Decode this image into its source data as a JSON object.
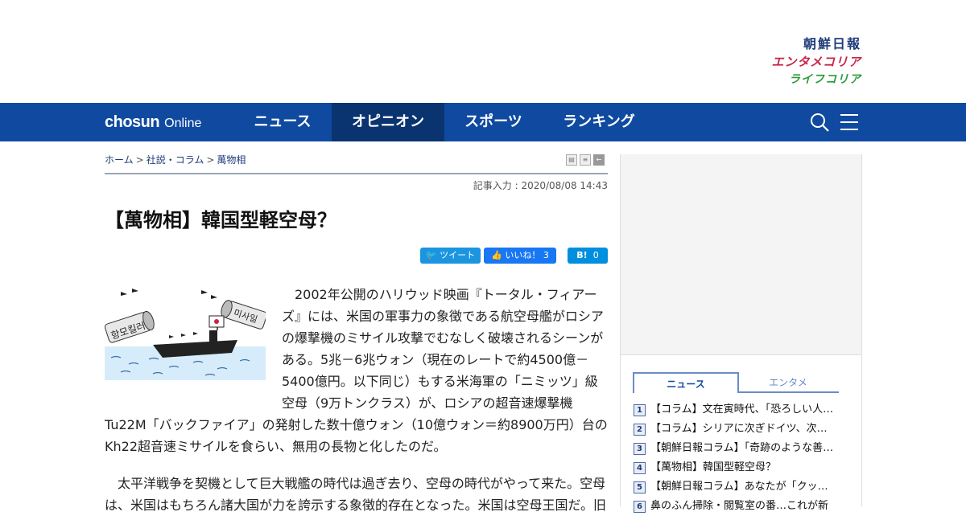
{
  "brands": {
    "main": "朝鮮日報",
    "enta": "エンタメコリア",
    "life": "ライフコリア"
  },
  "nav": {
    "logo_main": "chosun",
    "logo_sub": "Online",
    "items": [
      "ニュース",
      "オピニオン",
      "スポーツ",
      "ランキング"
    ],
    "active": "オピニオン",
    "icons": [
      "search-icon",
      "menu-icon"
    ]
  },
  "breadcrumb": {
    "home": "ホーム",
    "section": "社説・コラム",
    "current": "萬物相",
    "sep": ">"
  },
  "article": {
    "posted": "記事入力 : 2020/08/08 14:43",
    "title": "【萬物相】韓国型軽空母？",
    "image_text": {
      "left": "항모킬러",
      "right": "미사일"
    },
    "paragraphs": [
      "　2002年公開のハリウッド映画『トータル・フィアーズ』には、米国の軍事力の象徴である航空母艦がロシアの爆撃機のミサイル攻撃でむなしく破壊されるシーンがある。5兆－6兆ウォン（現在のレートで約4500億－5400億円。以下同じ）もする米海軍の「ニミッツ」級空母（9万トンクラス）が、ロシアの超音速爆撃機Tu22M「バックファイア」の発射した数十億ウォン（10億ウォン＝約8900万円）台のKh22超音速ミサイルを食らい、無用の長物と化したのだ。",
      "　太平洋戦争を契機として巨大戦艦の時代は過ぎ去り、空母の時代がやって来た。空母は、米国はもちろん諸大国が力を誇示する象徴的存在となった。米国は空母王国だ。旧"
    ]
  },
  "share": {
    "tweet": "ツイート",
    "like": "いいね！",
    "like_count": "3",
    "hatena": "B!",
    "hatena_count": "0"
  },
  "sidebar": {
    "tabs": [
      "ニュース",
      "エンタメ"
    ],
    "active_tab": "ニュース",
    "ranking": [
      {
        "num": "1",
        "text": "【コラム】文在寅時代、「恐ろしい人たち」"
      },
      {
        "num": "2",
        "text": "【コラム】シリアに次ぎドイツ、次は韓国か"
      },
      {
        "num": "3",
        "text": "【朝鮮日報コラム】「奇跡のような善意」"
      },
      {
        "num": "4",
        "text": "【萬物相】韓国型軽空母？"
      },
      {
        "num": "5",
        "text": "【朝鮮日報コラム】あなたが「クッポン」"
      },
      {
        "num": "6",
        "text": "鼻のふん掃除・閲覧室の番…これが新"
      }
    ]
  },
  "colors": {
    "nav_bg": "#0f4aa0",
    "nav_active": "#0a3470",
    "twitter": "#1b95e0",
    "facebook": "#1877f2",
    "hatena": "#008fde"
  }
}
